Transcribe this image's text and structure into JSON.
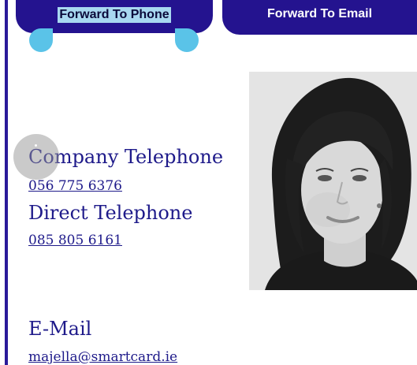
{
  "buttons": {
    "forward_phone": "Forward To Phone",
    "forward_email": "Forward To Email"
  },
  "contact": {
    "company_telephone_label": "Company Telephone",
    "company_telephone": "056 775 6376",
    "direct_telephone_label": "Direct Telephone",
    "direct_telephone": "085 805 6161",
    "email_label": "E-Mail",
    "email": "majella@smartcard.ie"
  },
  "colors": {
    "accent": "#24138f",
    "text": "#1e1a8a",
    "handle": "#5ac3e8",
    "selection": "#a8d8f0"
  },
  "photo": {
    "icon": "profile-photo"
  }
}
